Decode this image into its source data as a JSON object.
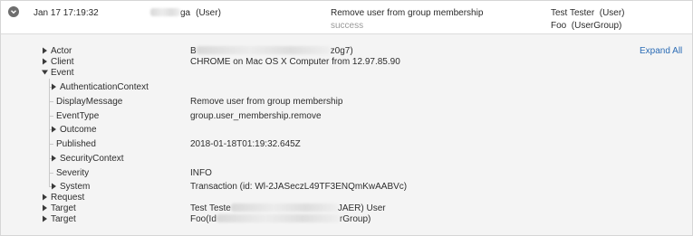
{
  "header": {
    "date": "Jan 17 17:19:32",
    "actor_suffix": "ga",
    "actor_type": "(User)",
    "event_title": "Remove user from group membership",
    "event_status": "success",
    "target1_name": "Test Tester",
    "target1_type": "(User)",
    "target2_name": "Foo",
    "target2_type": "(UserGroup)"
  },
  "expand_all_label": "Expand All",
  "details": {
    "actor_label": "Actor",
    "actor_prefix": "B",
    "actor_suffix": "z0g7)",
    "client_label": "Client",
    "client_value": "CHROME on Mac OS X Computer from 12.97.85.90",
    "event_label": "Event",
    "auth_label": "AuthenticationContext",
    "display_label": "DisplayMessage",
    "display_value": "Remove user from group membership",
    "type_label": "EventType",
    "type_value": "group.user_membership.remove",
    "outcome_label": "Outcome",
    "published_label": "Published",
    "published_value": "2018-01-18T01:19:32.645Z",
    "security_label": "SecurityContext",
    "severity_label": "Severity",
    "severity_value": "INFO",
    "system_label": "System",
    "system_value": "Transaction (id: Wl-2JASeczL49TF3ENQmKwAABVc)",
    "request_label": "Request",
    "target1_label": "Target",
    "target1_prefix": "Test Teste",
    "target1_suffix": "JAER) User",
    "target2_label": "Target",
    "target2_prefix": "Foo(Id",
    "target2_suffix": "rGroup)"
  },
  "icons": {
    "row_toggle": "chevron-down-circle-icon",
    "collapsed": "triangle-right-icon",
    "expanded": "triangle-down-icon"
  }
}
